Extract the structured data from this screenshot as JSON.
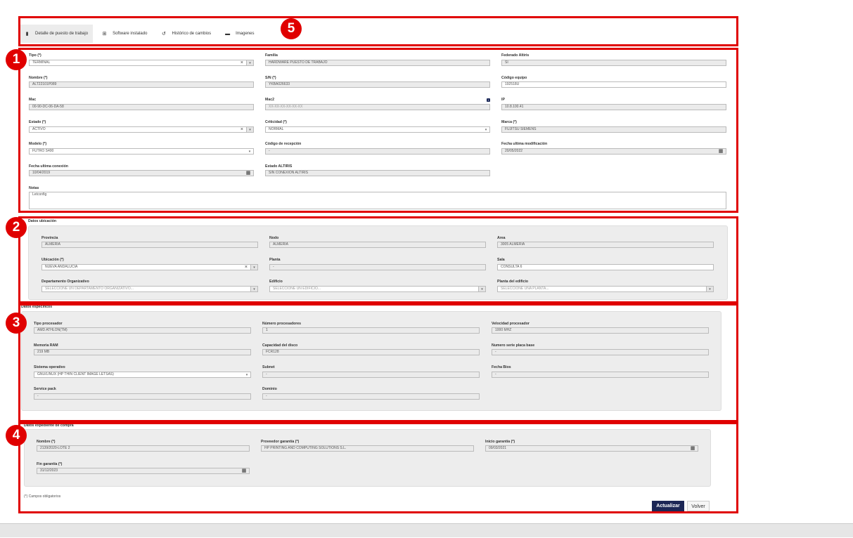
{
  "tabs": [
    {
      "label": "Detalle de puesto de trabajo",
      "icon": "document-icon",
      "active": true
    },
    {
      "label": "Software instalado",
      "icon": "windows-icon"
    },
    {
      "label": "Histórico de cambios",
      "icon": "history-icon"
    },
    {
      "label": "Imagenes",
      "icon": "image-icon"
    }
  ],
  "markers": [
    "1",
    "2",
    "3",
    "4",
    "5"
  ],
  "main": {
    "tipo": {
      "label": "Tipo (*)",
      "value": "TERMINAL"
    },
    "familia": {
      "label": "Familia",
      "value": "HARDWARE PUESTO DE TRABAJO"
    },
    "federado": {
      "label": "Federado Altiris",
      "value": "SI"
    },
    "nombre": {
      "label": "Nombre (*)",
      "value": "ALT22101P089"
    },
    "sn": {
      "label": "S/N (*)",
      "value": "YKBA026633"
    },
    "codigo_equipo": {
      "label": "Código equipo",
      "value": "192518U"
    },
    "mac": {
      "label": "Mac",
      "value": "00-90-DC-06-DA-58"
    },
    "mac2": {
      "label": "Mac2",
      "placeholder": "XX-XX-XX-XX-XX-XX",
      "info_icon": "i"
    },
    "ip": {
      "label": "IP",
      "value": "10.8.100.41"
    },
    "estado": {
      "label": "Estado (*)",
      "value": "ACTIVO"
    },
    "criticidad": {
      "label": "Criticidad (*)",
      "value": "NORMAL"
    },
    "marca": {
      "label": "Marca (*)",
      "value": "FUJITSU SIEMENS"
    },
    "modelo": {
      "label": "Modelo (*)",
      "value": "FUTRO S400"
    },
    "codigo_recepcion": {
      "label": "Código de recepción",
      "value": "-"
    },
    "fecha_mod": {
      "label": "Fecha ultima modificación",
      "value": "20/05/2022"
    },
    "fecha_conexion": {
      "label": "Fecha ultima conexión",
      "value": "10/04/2019"
    },
    "estado_altiris": {
      "label": "Estado ALTIRIS",
      "value": "SIN CONEXION ALTIRIS"
    },
    "notas": {
      "label": "Notas",
      "value": "Letconfig"
    }
  },
  "ubicacion": {
    "title": "Datos ubicación",
    "provincia": {
      "label": "Provincia",
      "value": "ALMERIA"
    },
    "nodo": {
      "label": "Nodo",
      "value": "ALMERIA"
    },
    "area": {
      "label": "Area",
      "value": "3005 ALMERIA"
    },
    "ubic": {
      "label": "Ubicación (*)",
      "value": "NUEVA ANDALUCIA"
    },
    "planta": {
      "label": "Planta",
      "value": "-"
    },
    "sala": {
      "label": "Sala",
      "value": "CONSULTA 6"
    },
    "depto": {
      "label": "Departamento Organizativo",
      "placeholder": "SELECCIONE UN DEPARTAMENTO ORGANIZATIVO..."
    },
    "edificio": {
      "label": "Edificio",
      "placeholder": "SELECCIONE UN EDIFICIO..."
    },
    "planta_edificio": {
      "label": "Planta del edificio",
      "placeholder": "SELECCIONE UNA PLANTA..."
    }
  },
  "especificos": {
    "title": "Datos específicos",
    "tipo_proc": {
      "label": "Tipo procesador",
      "value": "AMD ATHLON(TM)"
    },
    "num_proc": {
      "label": "Número procesadores",
      "value": "1"
    },
    "vel_proc": {
      "label": "Velocidad procesador",
      "value": "1000 MHZ"
    },
    "ram": {
      "label": "Memoria RAM",
      "value": "219 MB"
    },
    "disco": {
      "label": "Capacidad del disco",
      "value": "FCR128"
    },
    "placa": {
      "label": "Numero serie placa base",
      "value": "-"
    },
    "so": {
      "label": "Sistema operativo",
      "value": "GNU/LINUX (HP THIN CLIENT IMAGE LETSAS)"
    },
    "subnet": {
      "label": "Subnet",
      "value": "-"
    },
    "bios": {
      "label": "Fecha Bios",
      "value": "-"
    },
    "sp": {
      "label": "Service pack",
      "value": "-"
    },
    "dominio": {
      "label": "Dominio",
      "value": "-"
    }
  },
  "compra": {
    "title": "Datos expediente de compra",
    "nombre": {
      "label": "Nombre (*)",
      "value": "2139/2020-LOTE 2"
    },
    "proveedor": {
      "label": "Proveedor garantía (*)",
      "value": "HP PRINTING AND COMPUTING SOLUTIONS S.L."
    },
    "inicio": {
      "label": "Inicio garantía (*)",
      "value": "09/03/2021"
    },
    "fin": {
      "label": "Fin garantía (*)",
      "value": "31/12/2023"
    }
  },
  "footer": {
    "note": "(*) Campos obligatorios",
    "update_button": "Actualizar",
    "back_button": "Volver"
  }
}
